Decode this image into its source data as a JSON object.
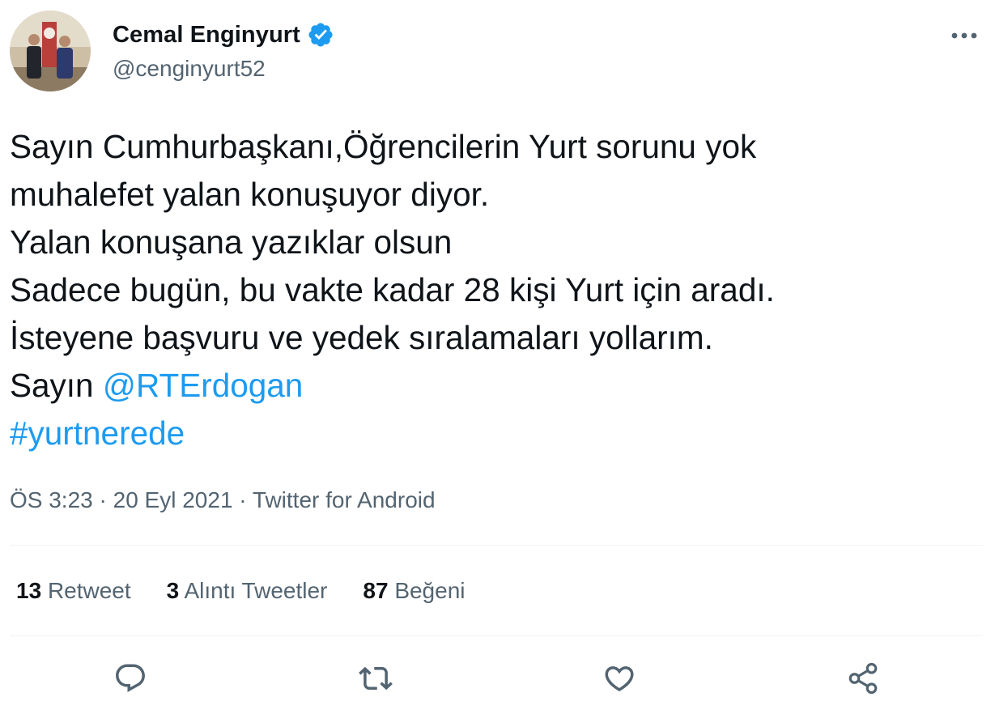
{
  "author": {
    "display_name": "Cemal Enginyurt",
    "handle": "@cenginyurt52",
    "verified": true,
    "avatar_icon": "profile-photo"
  },
  "tweet": {
    "lines": [
      "Sayın Cumhurbaşkanı,Öğrencilerin Yurt sorunu yok",
      "muhalefet yalan konuşuyor diyor.",
      "Yalan konuşana yazıklar olsun",
      "Sadece bugün, bu vakte kadar 28 kişi Yurt için aradı.",
      "İsteyene başvuru ve yedek sıralamaları yollarım."
    ],
    "mention_prefix": "Sayın ",
    "mention": "@RTErdogan",
    "hashtag": "#yurtnerede"
  },
  "meta": {
    "time": "ÖS 3:23",
    "separator": " · ",
    "date": "20 Eyl 2021",
    "source": "Twitter for Android"
  },
  "stats": {
    "retweets": {
      "count": "13",
      "label": "Retweet"
    },
    "quotes": {
      "count": "3",
      "label": "Alıntı Tweetler"
    },
    "likes": {
      "count": "87",
      "label": "Beğeni"
    }
  },
  "actions": [
    "reply-icon",
    "retweet-icon",
    "like-icon",
    "share-icon"
  ],
  "colors": {
    "text": "#0f1419",
    "secondary": "#536471",
    "link": "#1d9bf0",
    "divider": "#eff3f4"
  }
}
